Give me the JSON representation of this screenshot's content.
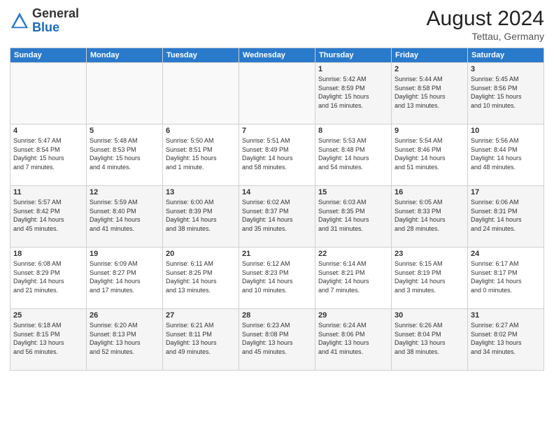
{
  "header": {
    "logo_general": "General",
    "logo_blue": "Blue",
    "title": "August 2024",
    "location": "Tettau, Germany"
  },
  "calendar": {
    "headers": [
      "Sunday",
      "Monday",
      "Tuesday",
      "Wednesday",
      "Thursday",
      "Friday",
      "Saturday"
    ],
    "weeks": [
      [
        {
          "day": "",
          "info": ""
        },
        {
          "day": "",
          "info": ""
        },
        {
          "day": "",
          "info": ""
        },
        {
          "day": "",
          "info": ""
        },
        {
          "day": "1",
          "info": "Sunrise: 5:42 AM\nSunset: 8:59 PM\nDaylight: 15 hours\nand 16 minutes."
        },
        {
          "day": "2",
          "info": "Sunrise: 5:44 AM\nSunset: 8:58 PM\nDaylight: 15 hours\nand 13 minutes."
        },
        {
          "day": "3",
          "info": "Sunrise: 5:45 AM\nSunset: 8:56 PM\nDaylight: 15 hours\nand 10 minutes."
        }
      ],
      [
        {
          "day": "4",
          "info": "Sunrise: 5:47 AM\nSunset: 8:54 PM\nDaylight: 15 hours\nand 7 minutes."
        },
        {
          "day": "5",
          "info": "Sunrise: 5:48 AM\nSunset: 8:53 PM\nDaylight: 15 hours\nand 4 minutes."
        },
        {
          "day": "6",
          "info": "Sunrise: 5:50 AM\nSunset: 8:51 PM\nDaylight: 15 hours\nand 1 minute."
        },
        {
          "day": "7",
          "info": "Sunrise: 5:51 AM\nSunset: 8:49 PM\nDaylight: 14 hours\nand 58 minutes."
        },
        {
          "day": "8",
          "info": "Sunrise: 5:53 AM\nSunset: 8:48 PM\nDaylight: 14 hours\nand 54 minutes."
        },
        {
          "day": "9",
          "info": "Sunrise: 5:54 AM\nSunset: 8:46 PM\nDaylight: 14 hours\nand 51 minutes."
        },
        {
          "day": "10",
          "info": "Sunrise: 5:56 AM\nSunset: 8:44 PM\nDaylight: 14 hours\nand 48 minutes."
        }
      ],
      [
        {
          "day": "11",
          "info": "Sunrise: 5:57 AM\nSunset: 8:42 PM\nDaylight: 14 hours\nand 45 minutes."
        },
        {
          "day": "12",
          "info": "Sunrise: 5:59 AM\nSunset: 8:40 PM\nDaylight: 14 hours\nand 41 minutes."
        },
        {
          "day": "13",
          "info": "Sunrise: 6:00 AM\nSunset: 8:39 PM\nDaylight: 14 hours\nand 38 minutes."
        },
        {
          "day": "14",
          "info": "Sunrise: 6:02 AM\nSunset: 8:37 PM\nDaylight: 14 hours\nand 35 minutes."
        },
        {
          "day": "15",
          "info": "Sunrise: 6:03 AM\nSunset: 8:35 PM\nDaylight: 14 hours\nand 31 minutes."
        },
        {
          "day": "16",
          "info": "Sunrise: 6:05 AM\nSunset: 8:33 PM\nDaylight: 14 hours\nand 28 minutes."
        },
        {
          "day": "17",
          "info": "Sunrise: 6:06 AM\nSunset: 8:31 PM\nDaylight: 14 hours\nand 24 minutes."
        }
      ],
      [
        {
          "day": "18",
          "info": "Sunrise: 6:08 AM\nSunset: 8:29 PM\nDaylight: 14 hours\nand 21 minutes."
        },
        {
          "day": "19",
          "info": "Sunrise: 6:09 AM\nSunset: 8:27 PM\nDaylight: 14 hours\nand 17 minutes."
        },
        {
          "day": "20",
          "info": "Sunrise: 6:11 AM\nSunset: 8:25 PM\nDaylight: 14 hours\nand 13 minutes."
        },
        {
          "day": "21",
          "info": "Sunrise: 6:12 AM\nSunset: 8:23 PM\nDaylight: 14 hours\nand 10 minutes."
        },
        {
          "day": "22",
          "info": "Sunrise: 6:14 AM\nSunset: 8:21 PM\nDaylight: 14 hours\nand 7 minutes."
        },
        {
          "day": "23",
          "info": "Sunrise: 6:15 AM\nSunset: 8:19 PM\nDaylight: 14 hours\nand 3 minutes."
        },
        {
          "day": "24",
          "info": "Sunrise: 6:17 AM\nSunset: 8:17 PM\nDaylight: 14 hours\nand 0 minutes."
        }
      ],
      [
        {
          "day": "25",
          "info": "Sunrise: 6:18 AM\nSunset: 8:15 PM\nDaylight: 13 hours\nand 56 minutes."
        },
        {
          "day": "26",
          "info": "Sunrise: 6:20 AM\nSunset: 8:13 PM\nDaylight: 13 hours\nand 52 minutes."
        },
        {
          "day": "27",
          "info": "Sunrise: 6:21 AM\nSunset: 8:11 PM\nDaylight: 13 hours\nand 49 minutes."
        },
        {
          "day": "28",
          "info": "Sunrise: 6:23 AM\nSunset: 8:08 PM\nDaylight: 13 hours\nand 45 minutes."
        },
        {
          "day": "29",
          "info": "Sunrise: 6:24 AM\nSunset: 8:06 PM\nDaylight: 13 hours\nand 41 minutes."
        },
        {
          "day": "30",
          "info": "Sunrise: 6:26 AM\nSunset: 8:04 PM\nDaylight: 13 hours\nand 38 minutes."
        },
        {
          "day": "31",
          "info": "Sunrise: 6:27 AM\nSunset: 8:02 PM\nDaylight: 13 hours\nand 34 minutes."
        }
      ]
    ]
  }
}
